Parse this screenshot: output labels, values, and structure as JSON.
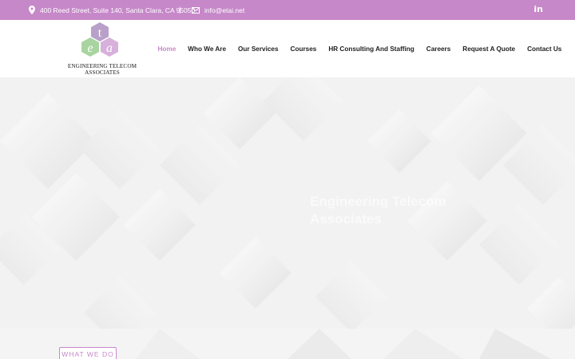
{
  "topbar": {
    "address": "400 Reed Street, Suite 140, Santa Clara, CA 95050",
    "separator": "|",
    "email": "info@etai.net",
    "social_icon": "linkedin-icon",
    "social_label": "in",
    "background": "#c688c9"
  },
  "logo": {
    "letters": [
      "t",
      "e",
      "a"
    ],
    "name_line1": "ENGINEERING TELECOM",
    "name_line2": "ASSOCIATES"
  },
  "nav": {
    "items": [
      {
        "label": "Home",
        "active": true
      },
      {
        "label": "Who We Are"
      },
      {
        "label": "Our Services"
      },
      {
        "label": "Courses"
      },
      {
        "label": "HR Consulting And Staffing"
      },
      {
        "label": "Careers"
      },
      {
        "label": "Request A Quote"
      },
      {
        "label": "Contact Us"
      }
    ],
    "active_color": "#c688c9"
  },
  "hero": {
    "title": "Engineering Telecom Associates"
  },
  "section": {
    "badge": "WHAT WE DO"
  }
}
